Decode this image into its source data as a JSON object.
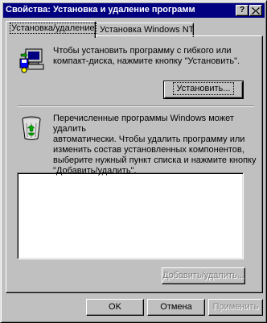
{
  "window": {
    "title": "Свойства: Установка и удаление программ",
    "help_label": "?",
    "close_label": "×",
    "colors": {
      "titlebar": "#000080",
      "face": "#c0c0c0"
    }
  },
  "tabs": [
    {
      "label": "Установка/удаление",
      "active": true
    },
    {
      "label": "Установка Windows NT",
      "active": false
    }
  ],
  "install": {
    "icon": "computer-disk-icon",
    "text": "Чтобы установить программу с гибкого или\nкомпакт-диска, нажмите кнопку \"Установить\".",
    "button_label": "Установить..."
  },
  "remove": {
    "icon": "recycle-bin-icon",
    "text": "Перечисленные программы Windows может удалить\nавтоматически. Чтобы удалить программу или\nизменить состав установленных компонентов,\nвыберите нужный пункт списка и нажмите кнопку\n\"Добавить/удалить\".",
    "list_items": [],
    "button_label": "Добавить/удалить..."
  },
  "footer": {
    "ok_label": "OK",
    "cancel_label": "Отмена",
    "apply_label": "Применить"
  }
}
